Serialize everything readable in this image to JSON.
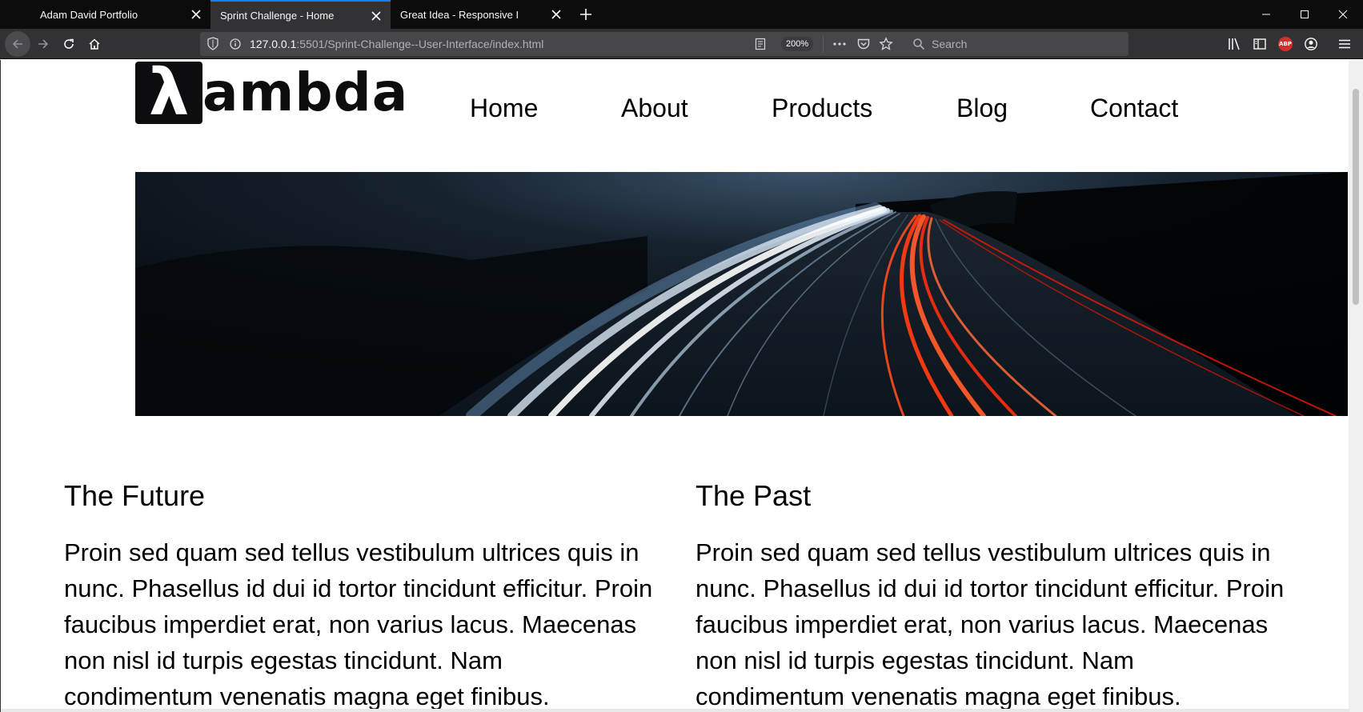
{
  "browser": {
    "tabs": [
      {
        "title": "Adam David Portfolio",
        "active": false
      },
      {
        "title": "Sprint Challenge - Home",
        "active": true
      },
      {
        "title": "Great Idea - Responsive I",
        "active": false
      }
    ],
    "url": {
      "host": "127.0.0.1",
      "rest": ":5501/Sprint-Challenge--User-Interface/index.html"
    },
    "zoom": "200%",
    "search_placeholder": "Search",
    "abp_label": "ABP",
    "accent_color": "#0a84ff"
  },
  "page": {
    "logo": {
      "mark": "λ",
      "word": "ambda"
    },
    "nav": [
      "Home",
      "About",
      "Products",
      "Blog",
      "Contact"
    ],
    "sections": [
      {
        "heading": "The Future",
        "body": "Proin sed quam sed tellus vestibulum ultrices quis in nunc. Phasellus id dui id tortor tincidunt efficitur. Proin faucibus imperdiet erat, non varius lacus. Maecenas non nisl id turpis egestas tincidunt. Nam condimentum venenatis magna eget finibus."
      },
      {
        "heading": "The Past",
        "body": "Proin sed quam sed tellus vestibulum ultrices quis in nunc. Phasellus id dui id tortor tincidunt efficitur. Proin faucibus imperdiet erat, non varius lacus. Maecenas non nisl id turpis egestas tincidunt. Nam condimentum venenatis magna eget finibus."
      }
    ]
  }
}
